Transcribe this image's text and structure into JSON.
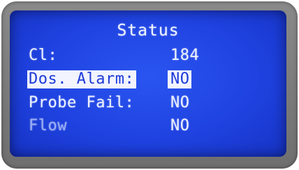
{
  "screen": {
    "title": "Status",
    "rows": [
      {
        "label": "Cl:",
        "value": "184",
        "selected": false
      },
      {
        "label": "Dos. Alarm:",
        "value": "NO",
        "selected": true
      },
      {
        "label": "Probe Fail:",
        "value": "NO",
        "selected": false
      },
      {
        "label": "Flow",
        "value": "NO",
        "selected": false
      }
    ]
  },
  "colors": {
    "lcd_background": "#1f42e0",
    "lcd_text": "#eef2ff",
    "highlight_background": "#f2f4ff",
    "highlight_text": "#1d3ad8",
    "bezel": "#7c7c7c"
  }
}
